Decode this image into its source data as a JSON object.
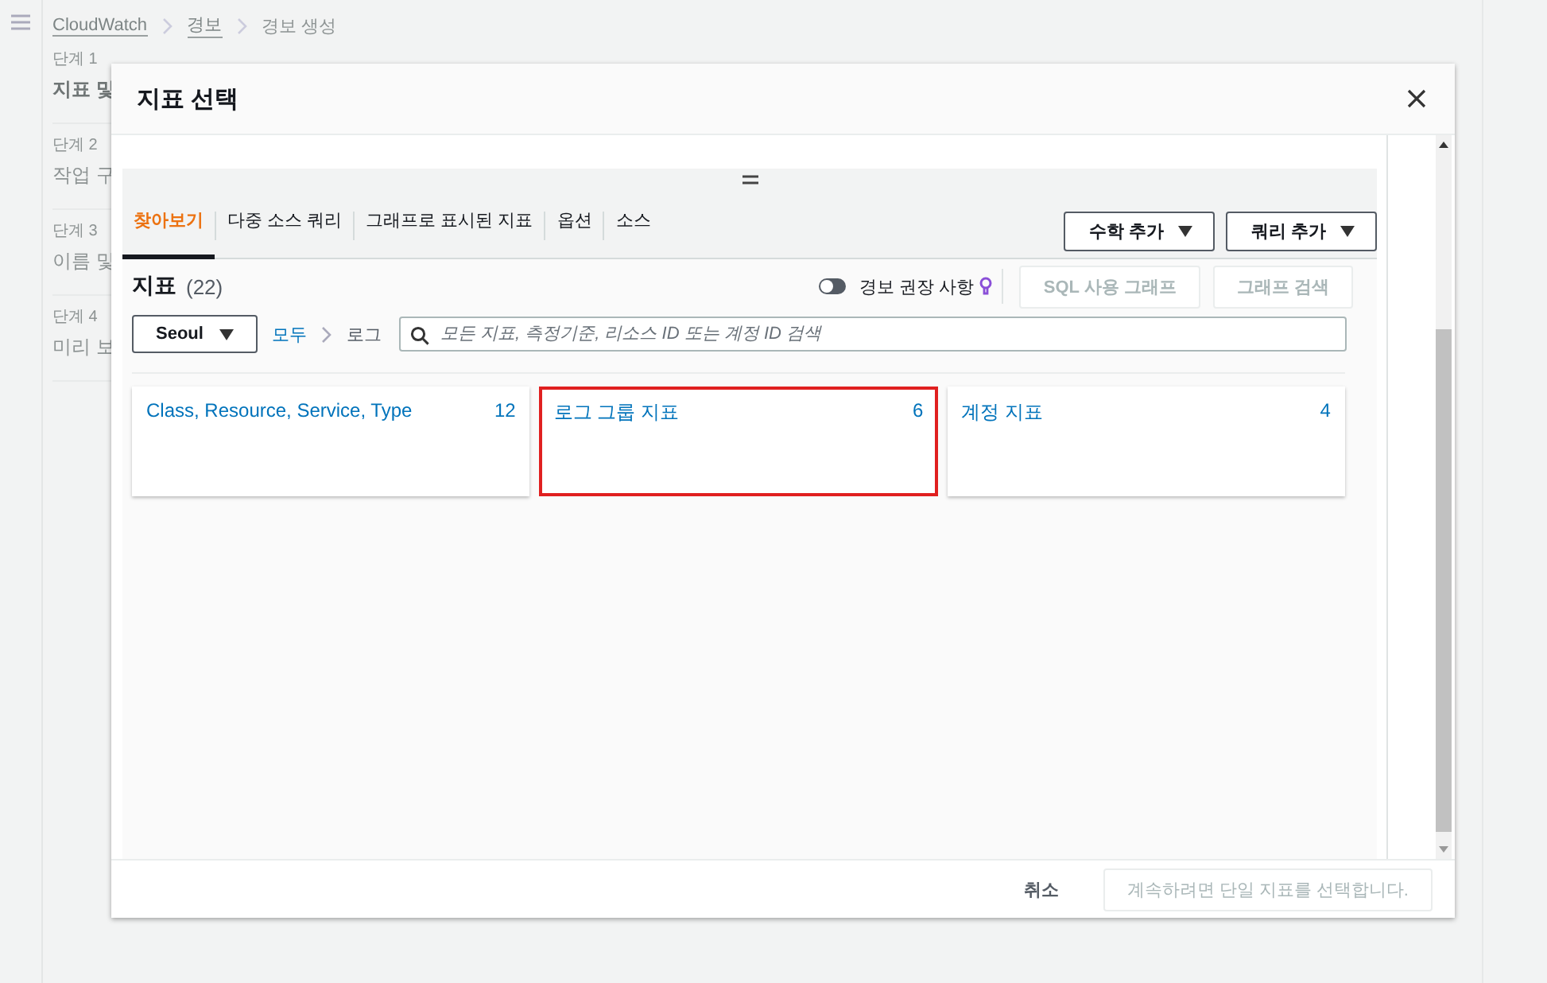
{
  "page": {
    "breadcrumbs": [
      {
        "label": "CloudWatch",
        "link": true
      },
      {
        "label": "경보",
        "link": true
      },
      {
        "label": "경보 생성",
        "link": false
      }
    ],
    "steps": [
      {
        "step": "단계 1",
        "title": "지표 및",
        "selected": true
      },
      {
        "step": "단계 2",
        "title": "작업 구",
        "selected": false
      },
      {
        "step": "단계 3",
        "title": "이름 및",
        "selected": false
      },
      {
        "step": "단계 4",
        "title": "미리 보",
        "selected": false
      }
    ]
  },
  "modal": {
    "title": "지표 선택",
    "tabs": [
      {
        "label": "찾아보기",
        "selected": true
      },
      {
        "label": "다중 소스 쿼리",
        "selected": false
      },
      {
        "label": "그래프로 표시된 지표",
        "selected": false
      },
      {
        "label": "옵션",
        "selected": false
      },
      {
        "label": "소스",
        "selected": false
      }
    ],
    "tab_buttons": [
      {
        "label": "수학 추가"
      },
      {
        "label": "쿼리 추가"
      }
    ],
    "metrics": {
      "title": "지표",
      "count": "(22)",
      "toggle": {
        "label": "경보 권장 사항",
        "on": false
      },
      "buttons": [
        {
          "label": "SQL 사용 그래프",
          "disabled": true
        },
        {
          "label": "그래프 검색",
          "disabled": true
        }
      ],
      "region": "Seoul",
      "path": [
        {
          "label": "모두",
          "link": true
        },
        {
          "label": "로그",
          "link": false
        }
      ],
      "search": {
        "placeholder": "모든 지표, 측정기준, 리소스 ID 또는 계정 ID 검색"
      },
      "cards": [
        {
          "label": "Class, Resource, Service, Type",
          "count": "12",
          "selected": false
        },
        {
          "label": "로그 그룹 지표",
          "count": "6",
          "selected": true
        },
        {
          "label": "계정 지표",
          "count": "4",
          "selected": false
        }
      ]
    },
    "footer": {
      "cancel": "취소",
      "confirm": {
        "label": "계속하려면 단일 지표를 선택합니다.",
        "disabled": true
      }
    }
  }
}
